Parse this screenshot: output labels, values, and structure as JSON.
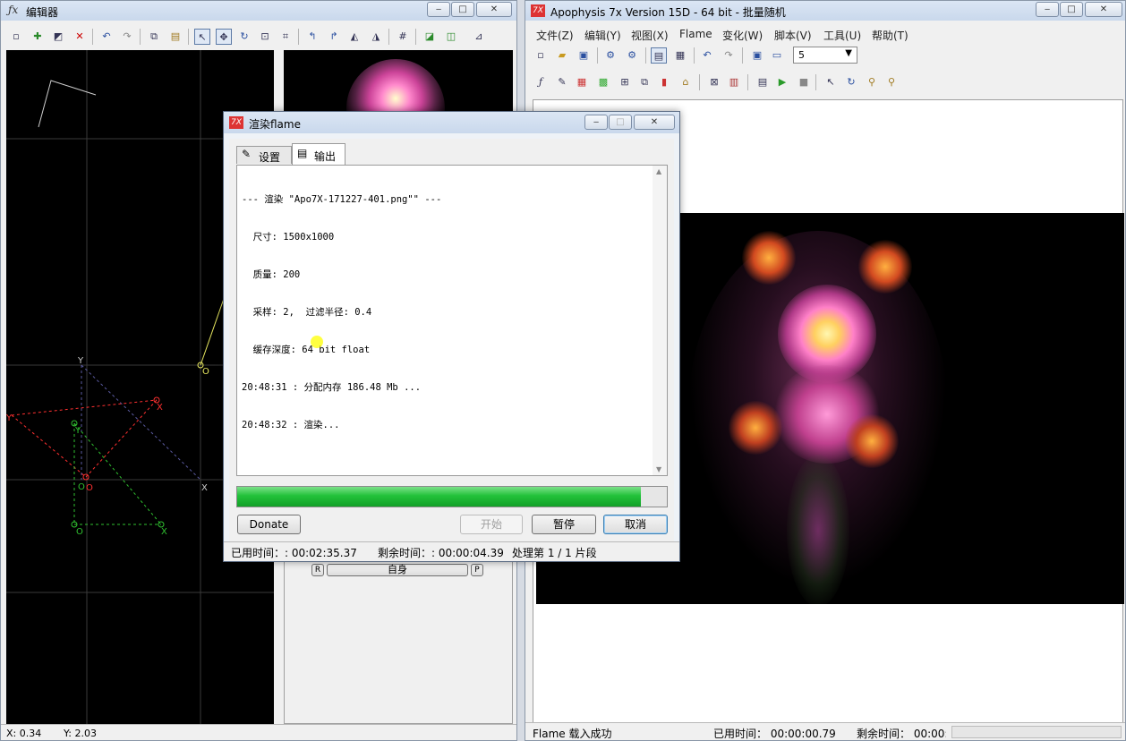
{
  "editor": {
    "title": "编辑器",
    "status": {
      "x": "X: 0.34",
      "y": "Y: 2.03"
    },
    "axis": {
      "x": "X",
      "y": "Y",
      "o": "O"
    },
    "self_label": "自身",
    "r_label": "R",
    "p_label": "P"
  },
  "main": {
    "title": "Apophysis 7x Version 15D  - 64 bit - 批量随机",
    "menu": [
      "文件(Z)",
      "编辑(Y)",
      "视图(X)",
      "Flame",
      "变化(W)",
      "脚本(V)",
      "工具(U)",
      "帮助(T)"
    ],
    "zoom_value": "5",
    "status": {
      "message": "Flame 载入成功",
      "elapsed": "已用时间： 00:00:00.79",
      "remaining": "剩余时间： 00:00:"
    }
  },
  "render_dialog": {
    "title": "渲染flame",
    "tabs": [
      "设置",
      "输出"
    ],
    "log": [
      "--- 渲染 \"Apo7X-171227-401.png\"\" ---",
      "  尺寸: 1500x1000",
      "  质量: 200",
      "  采样: 2,  过滤半径: 0.4",
      "  缓存深度: 64 bit float",
      "20:48:31 : 分配内存 186.48 Mb ...",
      "20:48:32 : 渲染..."
    ],
    "progress": 0.94,
    "buttons": {
      "donate": "Donate",
      "start": "开始",
      "pause": "暂停",
      "cancel": "取消"
    },
    "status": {
      "elapsed": "已用时间：: 00:02:35.37",
      "remaining": "剩余时间：: 00:00:04.39",
      "processing": "处理第 1 / 1 片段"
    }
  },
  "colors": {
    "accent": "#3399ff",
    "progress": "#22c23a",
    "canvas": "#000000"
  }
}
